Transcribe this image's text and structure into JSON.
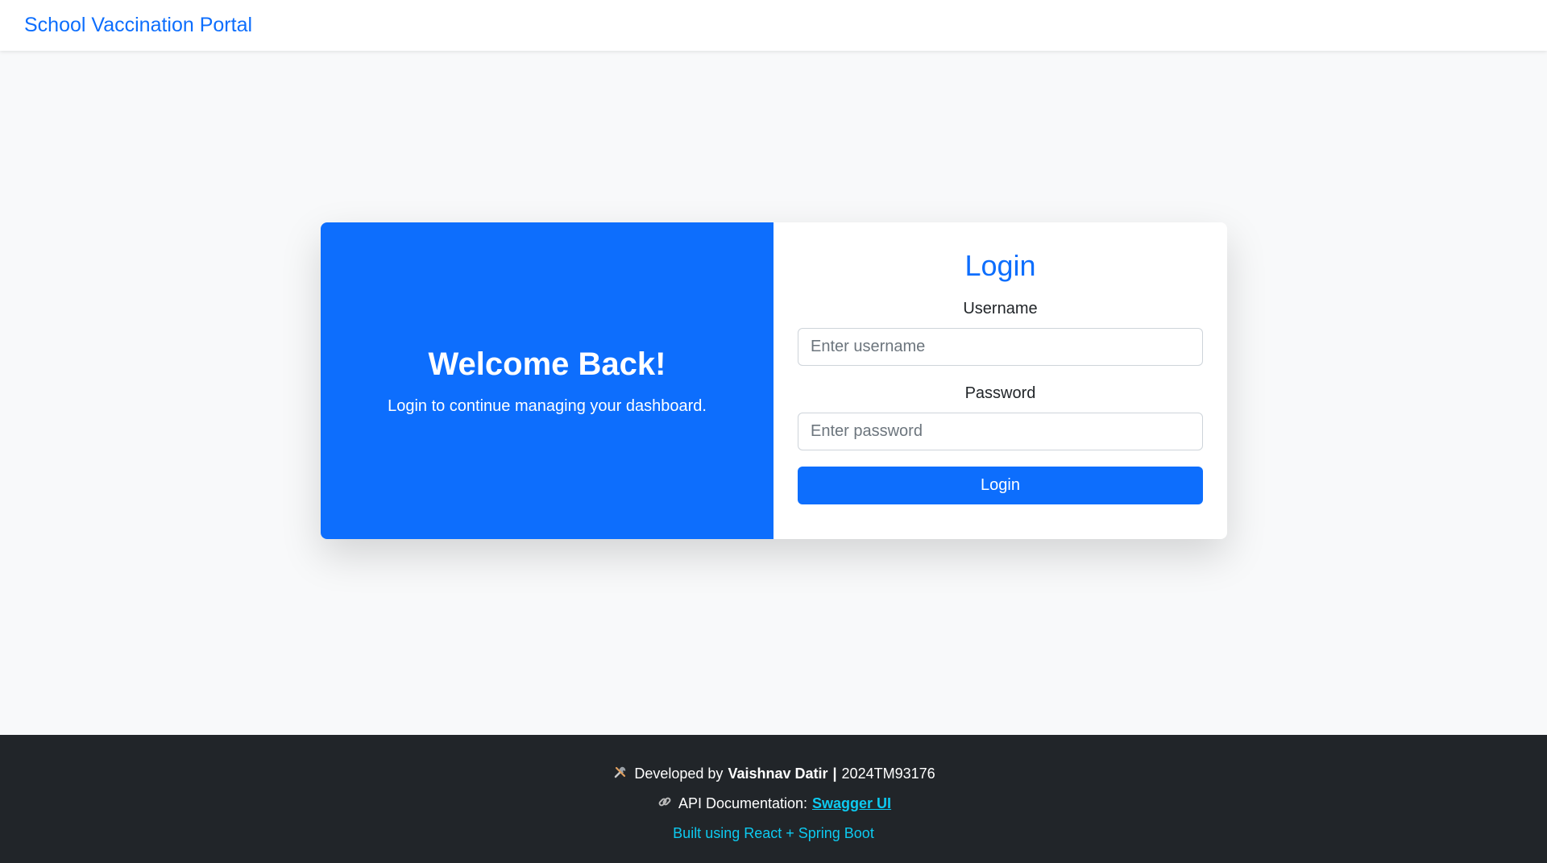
{
  "navbar": {
    "brand": "School Vaccination Portal"
  },
  "welcome": {
    "title": "Welcome Back!",
    "subtitle": "Login to continue managing your dashboard."
  },
  "login": {
    "title": "Login",
    "username_label": "Username",
    "username_placeholder": "Enter username",
    "password_label": "Password",
    "password_placeholder": "Enter password",
    "button_label": "Login"
  },
  "footer": {
    "developed_prefix": "Developed by",
    "developer_name": "Vaishnav Datir",
    "separator": "|",
    "developer_id": "2024TM93176",
    "api_prefix": "API Documentation:",
    "api_link_label": "Swagger UI",
    "built_with": "Built using React + Spring Boot"
  },
  "colors": {
    "primary": "#0d6efd",
    "footer_bg": "#212529",
    "link": "#0dcaf0",
    "page_bg": "#f8f9fa"
  },
  "icons": {
    "developer": "tools-icon",
    "api": "link-icon"
  }
}
